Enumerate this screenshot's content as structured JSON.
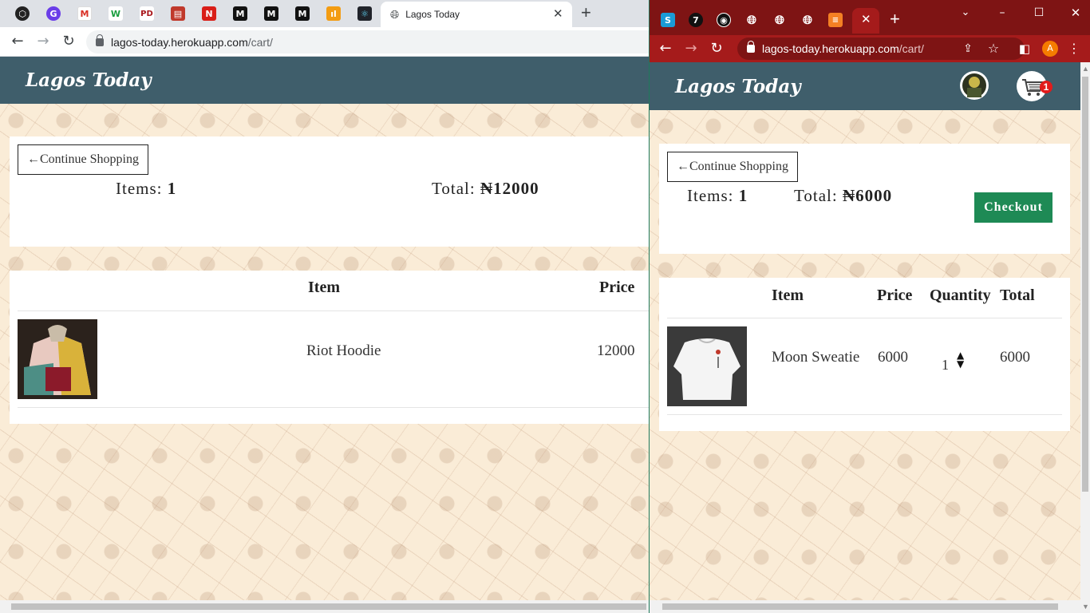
{
  "left": {
    "tabs": [
      "Lagos Today"
    ],
    "url": {
      "host": "lagos-today.herokuapp.com",
      "path": "/cart/"
    },
    "brand": "Lagos Today",
    "continue_label": "←Continue Shopping",
    "items_label": "Items:",
    "items_count": "1",
    "total_label": "Total:",
    "total_value": "₦12000",
    "table_headers": {
      "item": "Item",
      "price": "Price"
    },
    "rows": [
      {
        "name": "Riot Hoodie",
        "price": "12000"
      }
    ]
  },
  "right": {
    "url": {
      "host": "lagos-today.herokuapp.com",
      "path": "/cart/"
    },
    "brand": "Lagos Today",
    "cart_badge": "1",
    "profile_initial": "A",
    "continue_label": "←Continue Shopping",
    "items_label": "Items:",
    "items_count": "1",
    "total_label": "Total:",
    "total_value": "₦6000",
    "checkout_label": "Checkout",
    "table_headers": {
      "item": "Item",
      "price": "Price",
      "quantity": "Quantity",
      "total": "Total"
    },
    "rows": [
      {
        "name": "Moon Sweatie",
        "price": "6000",
        "quantity": "1",
        "total": "6000"
      }
    ]
  },
  "colors": {
    "brandbar": "#3f5e6b",
    "checkout": "#1e8a55",
    "right_tabstrip": "#7e1414",
    "right_toolbar": "#a51b1b",
    "badge": "#e21b1b"
  }
}
